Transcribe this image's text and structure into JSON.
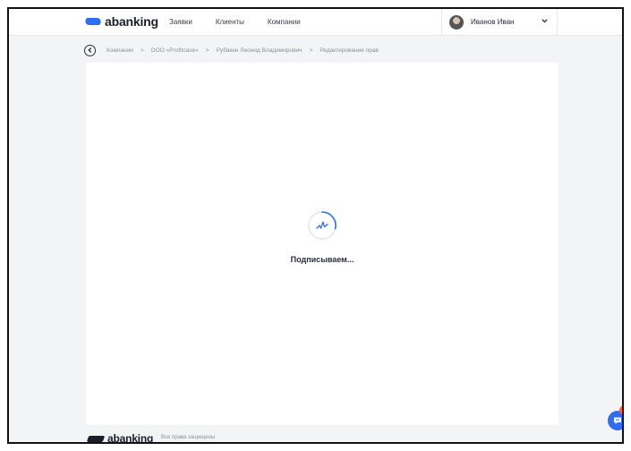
{
  "header": {
    "logo_text": "abanking",
    "nav": [
      {
        "label": "Заявки"
      },
      {
        "label": "Клиенты"
      },
      {
        "label": "Компании"
      }
    ],
    "user": {
      "name": "Иванов Иван"
    }
  },
  "breadcrumb": {
    "items": [
      {
        "label": "Компании"
      },
      {
        "label": "ООО «Profitcase»"
      },
      {
        "label": "Рубакин Леонид Владимирович"
      },
      {
        "label": "Редактирование прав"
      }
    ],
    "separator": ">"
  },
  "main": {
    "status_text": "Подписываем..."
  },
  "footer": {
    "logo_text": "abanking",
    "copyright": "Все права защищены"
  },
  "chat": {
    "badge_count": "1"
  },
  "colors": {
    "accent": "#2f6df6",
    "badge": "#ff5a3c",
    "background": "#f3f4f6"
  }
}
